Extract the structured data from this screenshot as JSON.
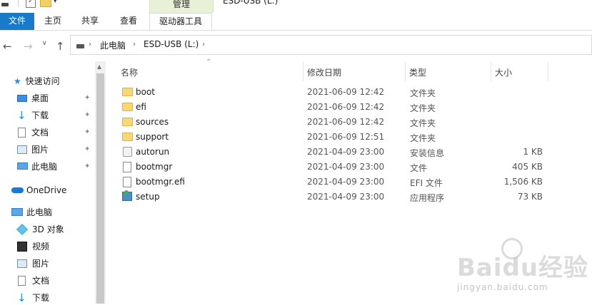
{
  "window_title": "ESD-USB (L:)",
  "ribbon": {
    "context_header": "管理",
    "tabs": [
      {
        "label": "文件"
      },
      {
        "label": "主页"
      },
      {
        "label": "共享"
      },
      {
        "label": "查看"
      },
      {
        "label": "驱动器工具"
      }
    ]
  },
  "address": {
    "crumbs": [
      "此电脑",
      "ESD-USB (L:)"
    ],
    "separator": "›"
  },
  "nav_pane": {
    "quick_access": "快速访问",
    "pinned": [
      {
        "label": "桌面",
        "icon": "desktop-icon"
      },
      {
        "label": "下载",
        "icon": "download-icon"
      },
      {
        "label": "文档",
        "icon": "documents-icon"
      },
      {
        "label": "图片",
        "icon": "pictures-icon"
      },
      {
        "label": "此电脑",
        "icon": "this-pc-icon"
      }
    ],
    "onedrive": "OneDrive",
    "this_pc": "此电脑",
    "pc_items": [
      {
        "label": "3D 对象",
        "icon": "3d-objects-icon"
      },
      {
        "label": "视频",
        "icon": "videos-icon"
      },
      {
        "label": "图片",
        "icon": "pictures-icon"
      },
      {
        "label": "文档",
        "icon": "documents-icon"
      },
      {
        "label": "下载",
        "icon": "download-icon"
      }
    ]
  },
  "columns": {
    "name": "名称",
    "date": "修改日期",
    "type": "类型",
    "size": "大小"
  },
  "files": [
    {
      "name": "boot",
      "date": "2021-06-09 12:42",
      "type": "文件夹",
      "size": "",
      "icon": "folder-icon"
    },
    {
      "name": "efi",
      "date": "2021-06-09 12:42",
      "type": "文件夹",
      "size": "",
      "icon": "folder-icon"
    },
    {
      "name": "sources",
      "date": "2021-06-09 12:42",
      "type": "文件夹",
      "size": "",
      "icon": "folder-icon"
    },
    {
      "name": "support",
      "date": "2021-06-09 12:51",
      "type": "文件夹",
      "size": "",
      "icon": "folder-icon"
    },
    {
      "name": "autorun",
      "date": "2021-04-09 23:00",
      "type": "安装信息",
      "size": "1 KB",
      "icon": "setup-info-icon"
    },
    {
      "name": "bootmgr",
      "date": "2021-04-09 23:00",
      "type": "文件",
      "size": "405 KB",
      "icon": "file-icon"
    },
    {
      "name": "bootmgr.efi",
      "date": "2021-04-09 23:00",
      "type": "EFI 文件",
      "size": "1,506 KB",
      "icon": "file-icon"
    },
    {
      "name": "setup",
      "date": "2021-04-09 23:00",
      "type": "应用程序",
      "size": "73 KB",
      "icon": "setup-app-icon"
    }
  ],
  "watermark": {
    "logo_text": "Baidu经验",
    "url": "jingyan.baidu.com"
  },
  "colors": {
    "file_tab": "#1979ca",
    "context_header": "#e8f1d6",
    "folder": "#f8d775"
  }
}
